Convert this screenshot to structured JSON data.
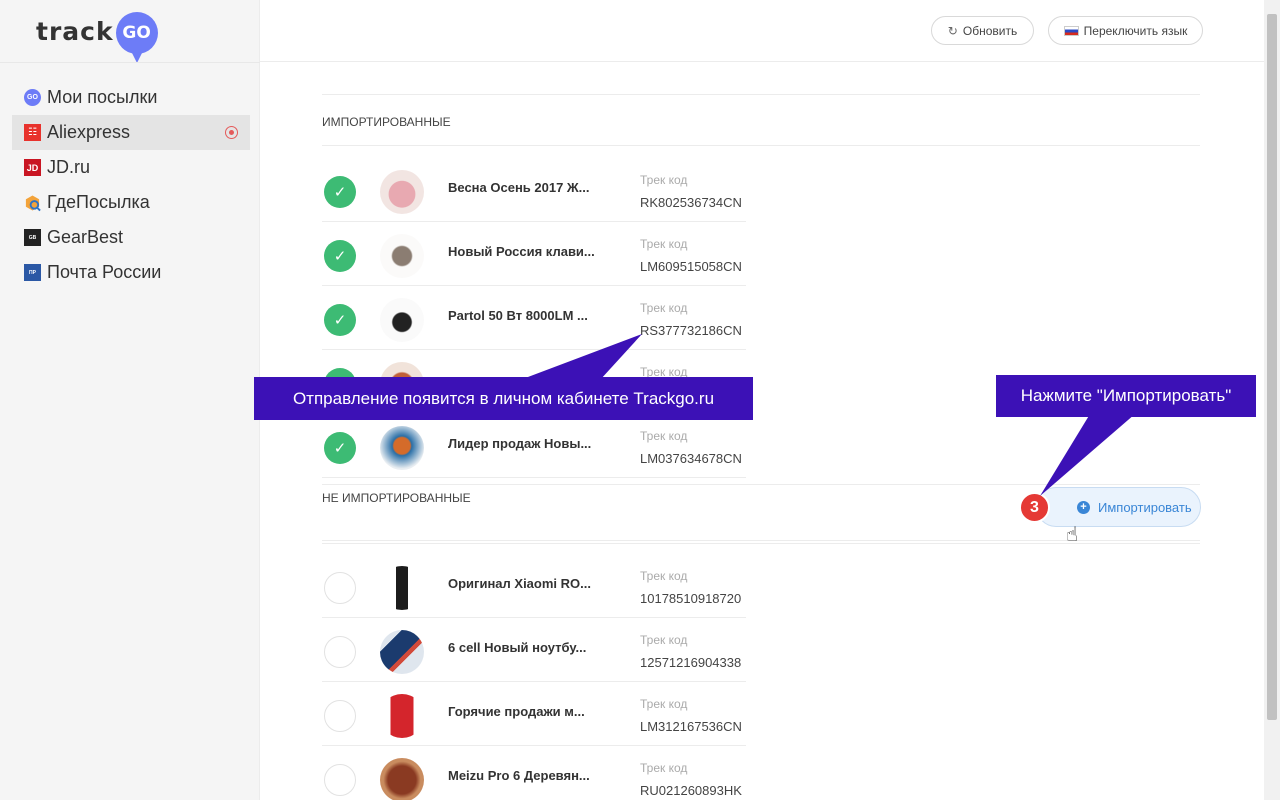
{
  "logo": {
    "text": "track",
    "badge": "GO"
  },
  "header": {
    "refresh_label": "Обновить",
    "lang_label": "Переключить язык"
  },
  "sidebar": {
    "items": [
      {
        "label": "Мои посылки",
        "icon": "trackgo-icon",
        "badge": "GO"
      },
      {
        "label": "Aliexpress",
        "icon": "aliexpress-icon",
        "badge": "AE",
        "active": true
      },
      {
        "label": "JD.ru",
        "icon": "jd-icon",
        "badge": "JD"
      },
      {
        "label": "ГдеПосылка",
        "icon": "gdeposylka-icon",
        "badge": ""
      },
      {
        "label": "GearBest",
        "icon": "gearbest-icon",
        "badge": ""
      },
      {
        "label": "Почта России",
        "icon": "pochta-rossii-icon",
        "badge": ""
      }
    ]
  },
  "imported": {
    "title": "ИМПОРТИРОВАННЫЕ",
    "track_label": "Трек код",
    "rows": [
      {
        "name": "Весна Осень 2017 Ж...",
        "code": "RK802536734CN",
        "checked": true
      },
      {
        "name": "Новый Россия клави...",
        "code": "LM609515058CN",
        "checked": true
      },
      {
        "name": "Partol 50 Вт 8000LM ...",
        "code": "RS377732186CN",
        "checked": true
      },
      {
        "name": "",
        "code": "",
        "checked": true
      },
      {
        "name": "Лидер продаж Новы...",
        "code": "LM037634678CN",
        "checked": true
      }
    ]
  },
  "not_imported": {
    "title": "НЕ ИМПОРТИРОВАННЫЕ",
    "import_button": "Импортировать",
    "track_label": "Трек код",
    "rows": [
      {
        "name": "Оригинал Xiaomi RO...",
        "code": "10178510918720",
        "checked": false
      },
      {
        "name": "6 cell Новый ноутбу...",
        "code": "12571216904338",
        "checked": false
      },
      {
        "name": "Горячие продажи м...",
        "code": "LM312167536CN",
        "checked": false
      },
      {
        "name": "Meizu Pro 6 Деревян...",
        "code": "RU021260893HK",
        "checked": false
      }
    ]
  },
  "callouts": {
    "left": "Отправление появится в личном кабинете Trackgo.ru",
    "right": "Нажмите \"Импортировать\"",
    "step": "3"
  },
  "colors": {
    "callout": "#3c11b6",
    "check": "#3dbb74",
    "accent": "#3a86d6",
    "badge": "#e53935"
  }
}
